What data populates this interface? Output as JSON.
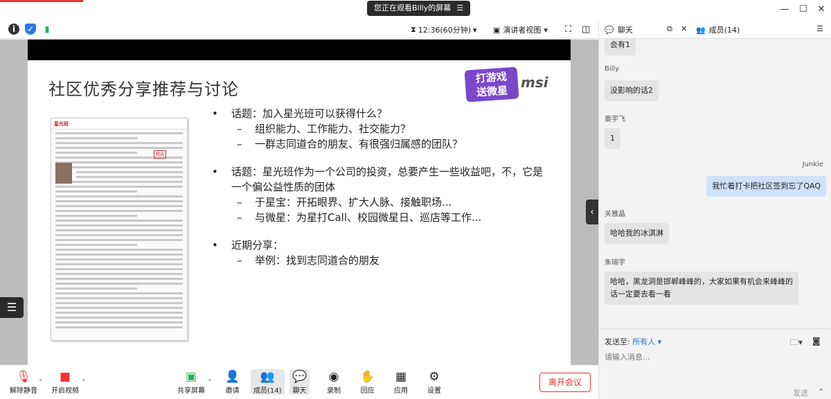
{
  "titlebar": {
    "share_banner": "您正在观看Billy的屏幕",
    "banner_menu_icon": "menu-icon",
    "minimize": "—",
    "maximize": "☐",
    "close": "✕"
  },
  "toolbar": {
    "timer": "12:36(60分钟)",
    "view_mode": "演讲者视图",
    "icons": [
      "info-icon",
      "shield-icon",
      "signal-icon",
      "hourglass-icon",
      "view-icon",
      "fullscreen-icon",
      "layout-icon"
    ]
  },
  "slide": {
    "title": "社区优秀分享推荐与讨论",
    "logo_game_line1": "打游戏",
    "logo_game_line2": "送微星",
    "logo_brand": "msi",
    "article_header": "星光班",
    "article_stamp": "精选",
    "b1": "话题：加入星光班可以获得什么？",
    "b1_1": "组织能力、工作能力、社交能力？",
    "b1_2": "一群志同道合的朋友、有很强归属感的团队？",
    "b2": "话题：星光班作为一个公司的投资，总要产生一些收益吧，不，它是一个偏公益性质的团体",
    "b2_1": "于星宝：开拓眼界、扩大人脉、接触职场...",
    "b2_2": "与微星：为星打Call、校园微星日、巡店等工作...",
    "b3": "近期分享：",
    "b3_1": "举例：找到志同道合的朋友"
  },
  "bottom": {
    "mute": "解除静音",
    "video": "开启视频",
    "share": "共享屏幕",
    "invite": "邀请",
    "members": "成员(14)",
    "chat": "聊天",
    "record": "录制",
    "react": "回应",
    "apps": "应用",
    "settings": "设置",
    "leave": "离开会议"
  },
  "panel": {
    "chat_tab": "聊天",
    "members_tab": "成员(14)",
    "messages": [
      {
        "sender": "",
        "text": "会有1"
      },
      {
        "sender": "Billy",
        "text": "没影响的话2"
      },
      {
        "sender": "姜宇飞",
        "text": "1"
      },
      {
        "sender": "Junkie",
        "text": "我忙着打卡把社区签到忘了QAQ"
      },
      {
        "sender": "关雅晶",
        "text": "哈哈我的冰淇淋"
      },
      {
        "sender": "朱瑞宇",
        "text": "哈哈，黑龙洞是邯郸峰峰的，大家如果有机会来峰峰的话一定要去看一看"
      }
    ],
    "send_to_label": "发送至:",
    "send_to_target": "所有人",
    "input_placeholder": "请输入消息...",
    "send": "发送"
  }
}
